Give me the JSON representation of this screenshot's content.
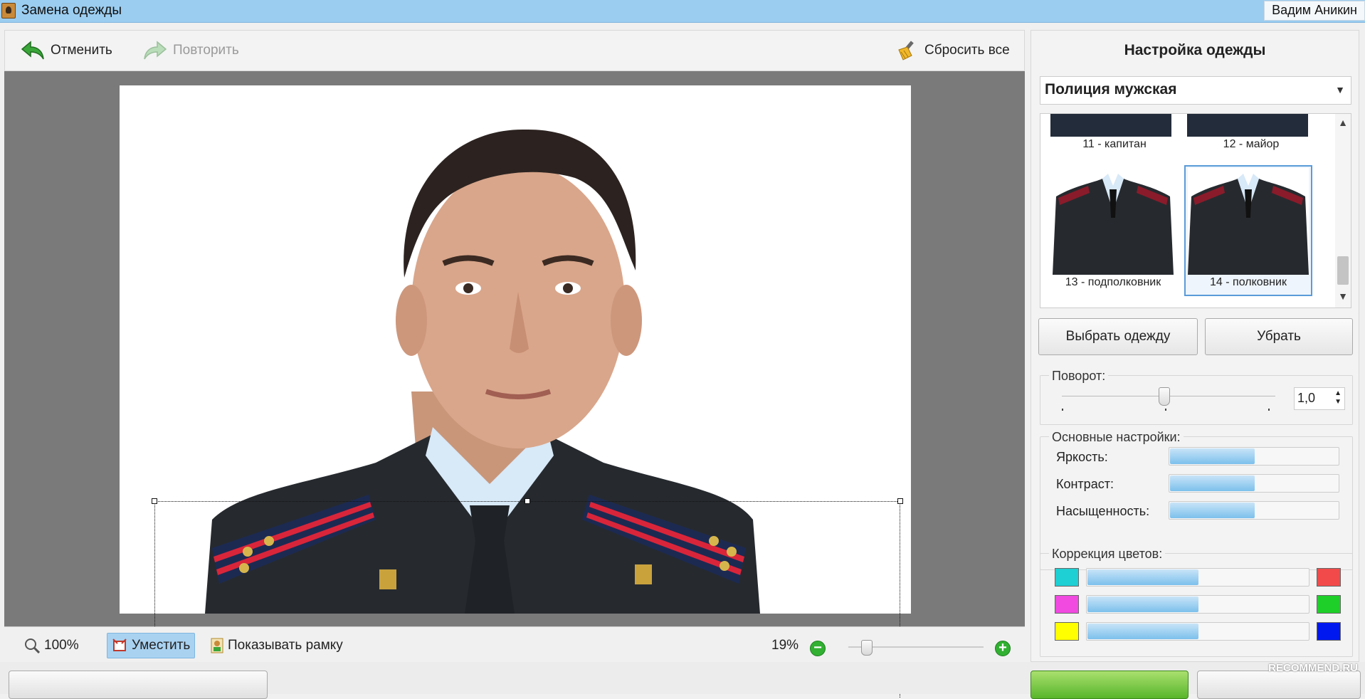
{
  "window": {
    "title": "Замена одежды",
    "user": "Вадим Аникин"
  },
  "toolbar": {
    "undo_label": "Отменить",
    "redo_label": "Повторить",
    "reset_label": "Сбросить все"
  },
  "statusbar": {
    "zoom_100_label": "100%",
    "fit_label": "Уместить",
    "show_frame_label": "Показывать рамку",
    "zoom_percent": "19%"
  },
  "panel": {
    "title": "Настройка одежды",
    "category": "Полиция мужская",
    "gallery": [
      {
        "label": "11 - капитан"
      },
      {
        "label": "12 - майор"
      },
      {
        "label": "13 - подполковник"
      },
      {
        "label": "14 - полковник",
        "selected": true
      }
    ],
    "choose_label": "Выбрать одежду",
    "remove_label": "Убрать",
    "rotation": {
      "title": "Поворот:",
      "value": "1,0"
    },
    "basic": {
      "title": "Основные настройки:",
      "brightness_label": "Яркость:",
      "contrast_label": "Контраст:",
      "saturation_label": "Насыщенность:",
      "brightness": 0.5,
      "contrast": 0.5,
      "saturation": 0.5
    },
    "color": {
      "title": "Коррекция цветов:",
      "rows": [
        {
          "left": "#1ecfd3",
          "right": "#f24a4a",
          "level": 0.5
        },
        {
          "left": "#f04ae0",
          "right": "#1ecf2a",
          "level": 0.5
        },
        {
          "left": "#ffff00",
          "right": "#0018f0",
          "level": 0.5
        }
      ]
    }
  },
  "watermark": "RECOMMEND.RU"
}
